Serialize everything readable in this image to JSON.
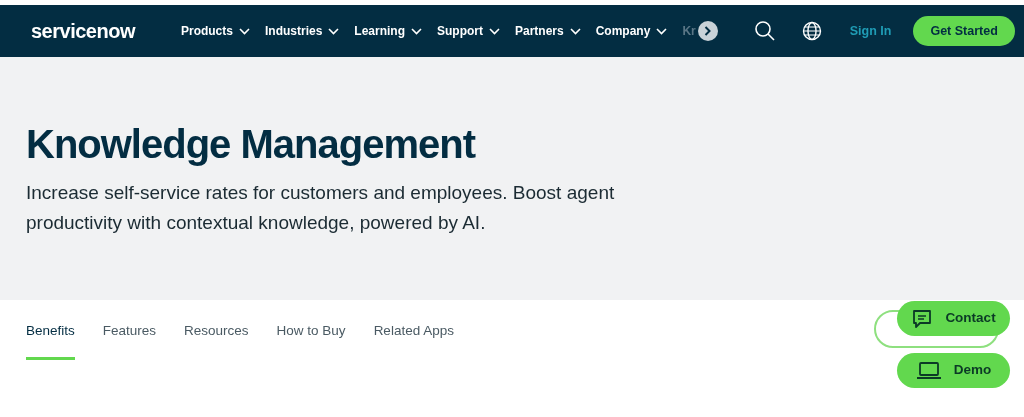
{
  "nav": {
    "logo": "servicenow",
    "items": [
      {
        "label": "Products"
      },
      {
        "label": "Industries"
      },
      {
        "label": "Learning"
      },
      {
        "label": "Support"
      },
      {
        "label": "Partners"
      },
      {
        "label": "Company"
      }
    ],
    "overflow_label": "Kr",
    "sign_in": "Sign In",
    "cta": "Get Started"
  },
  "hero": {
    "title": "Knowledge Management",
    "subtitle": "Increase self-service rates for customers and employees. Boost agent productivity with contextual knowledge, powered by AI."
  },
  "tabs": [
    {
      "label": "Benefits",
      "selected": true
    },
    {
      "label": "Features",
      "selected": false
    },
    {
      "label": "Resources",
      "selected": false
    },
    {
      "label": "How to Buy",
      "selected": false
    },
    {
      "label": "Related Apps",
      "selected": false
    }
  ],
  "floating": [
    {
      "label": "Contact",
      "kind": "chat"
    },
    {
      "label": "Demo",
      "kind": "laptop"
    }
  ]
}
